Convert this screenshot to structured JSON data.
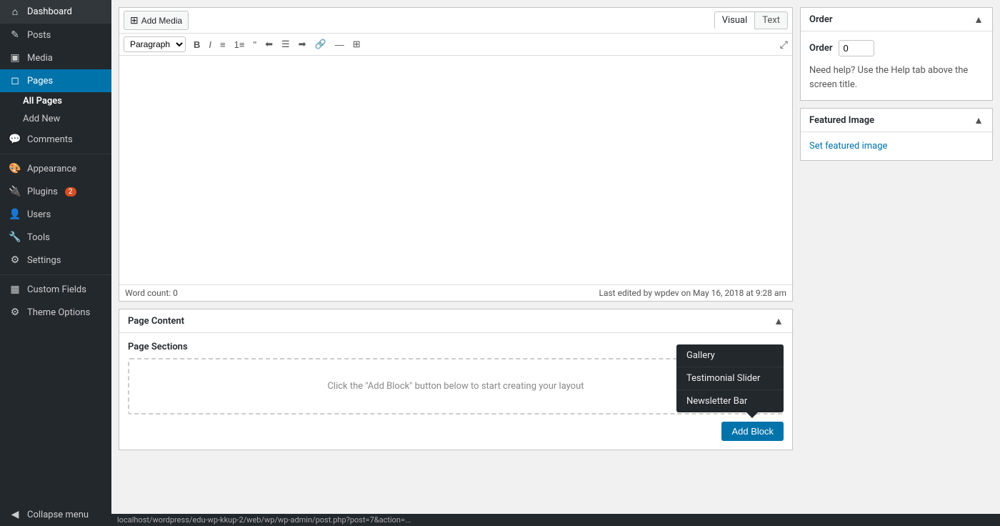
{
  "sidebar": {
    "items": [
      {
        "id": "dashboard",
        "label": "Dashboard",
        "icon": "⌂",
        "badge": null
      },
      {
        "id": "posts",
        "label": "Posts",
        "icon": "✎",
        "badge": null
      },
      {
        "id": "media",
        "label": "Media",
        "icon": "🖼",
        "badge": null
      },
      {
        "id": "pages",
        "label": "Pages",
        "icon": "📄",
        "badge": null,
        "active": true
      },
      {
        "id": "comments",
        "label": "Comments",
        "icon": "💬",
        "badge": null
      },
      {
        "id": "appearance",
        "label": "Appearance",
        "icon": "🎨",
        "badge": null
      },
      {
        "id": "plugins",
        "label": "Plugins",
        "icon": "🔌",
        "badge": "2"
      },
      {
        "id": "users",
        "label": "Users",
        "icon": "👤",
        "badge": null
      },
      {
        "id": "tools",
        "label": "Tools",
        "icon": "🔧",
        "badge": null
      },
      {
        "id": "settings",
        "label": "Settings",
        "icon": "⚙",
        "badge": null
      },
      {
        "id": "custom-fields",
        "label": "Custom Fields",
        "icon": "▦",
        "badge": null
      },
      {
        "id": "theme-options",
        "label": "Theme Options",
        "icon": "⚙",
        "badge": null
      }
    ],
    "sub_items": {
      "pages": [
        {
          "id": "all-pages",
          "label": "All Pages",
          "active": true
        },
        {
          "id": "add-new",
          "label": "Add New",
          "active": false
        }
      ]
    },
    "collapse_label": "Collapse menu"
  },
  "editor": {
    "add_media_label": "Add Media",
    "tab_visual": "Visual",
    "tab_text": "Text",
    "format_options": [
      "Paragraph"
    ],
    "word_count_label": "Word count: 0",
    "last_edited_label": "Last edited by wpdev on May 16, 2018 at 9:28 am"
  },
  "order_box": {
    "title": "Order",
    "label": "Order",
    "value": "0",
    "help_text": "Need help? Use the Help tab above the screen title."
  },
  "featured_image": {
    "title": "Featured Image",
    "set_link": "Set featured image"
  },
  "page_content": {
    "title": "Page Content",
    "sections_label": "Page Sections",
    "empty_message": "Click the \"Add Block\" button below to start creating your layout",
    "popup_items": [
      "Gallery",
      "Testimonial Slider",
      "Newsletter Bar"
    ],
    "add_block_label": "Add Block"
  },
  "status_bar": {
    "url": "localhost/wordpress/edu-wp-kkup-2/web/wp/wp-admin/post.php?post=7&action=..."
  }
}
